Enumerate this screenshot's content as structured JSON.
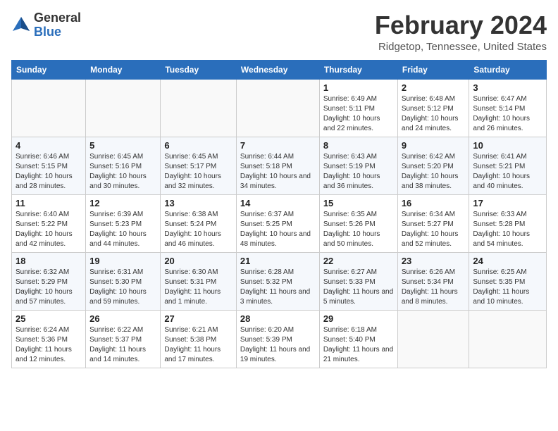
{
  "header": {
    "logo_general": "General",
    "logo_blue": "Blue",
    "title": "February 2024",
    "subtitle": "Ridgetop, Tennessee, United States"
  },
  "weekdays": [
    "Sunday",
    "Monday",
    "Tuesday",
    "Wednesday",
    "Thursday",
    "Friday",
    "Saturday"
  ],
  "weeks": [
    [
      {
        "day": "",
        "sunrise": "",
        "sunset": "",
        "daylight": "",
        "empty": true
      },
      {
        "day": "",
        "sunrise": "",
        "sunset": "",
        "daylight": "",
        "empty": true
      },
      {
        "day": "",
        "sunrise": "",
        "sunset": "",
        "daylight": "",
        "empty": true
      },
      {
        "day": "",
        "sunrise": "",
        "sunset": "",
        "daylight": "",
        "empty": true
      },
      {
        "day": "1",
        "sunrise": "Sunrise: 6:49 AM",
        "sunset": "Sunset: 5:11 PM",
        "daylight": "Daylight: 10 hours and 22 minutes.",
        "empty": false
      },
      {
        "day": "2",
        "sunrise": "Sunrise: 6:48 AM",
        "sunset": "Sunset: 5:12 PM",
        "daylight": "Daylight: 10 hours and 24 minutes.",
        "empty": false
      },
      {
        "day": "3",
        "sunrise": "Sunrise: 6:47 AM",
        "sunset": "Sunset: 5:14 PM",
        "daylight": "Daylight: 10 hours and 26 minutes.",
        "empty": false
      }
    ],
    [
      {
        "day": "4",
        "sunrise": "Sunrise: 6:46 AM",
        "sunset": "Sunset: 5:15 PM",
        "daylight": "Daylight: 10 hours and 28 minutes.",
        "empty": false
      },
      {
        "day": "5",
        "sunrise": "Sunrise: 6:45 AM",
        "sunset": "Sunset: 5:16 PM",
        "daylight": "Daylight: 10 hours and 30 minutes.",
        "empty": false
      },
      {
        "day": "6",
        "sunrise": "Sunrise: 6:45 AM",
        "sunset": "Sunset: 5:17 PM",
        "daylight": "Daylight: 10 hours and 32 minutes.",
        "empty": false
      },
      {
        "day": "7",
        "sunrise": "Sunrise: 6:44 AM",
        "sunset": "Sunset: 5:18 PM",
        "daylight": "Daylight: 10 hours and 34 minutes.",
        "empty": false
      },
      {
        "day": "8",
        "sunrise": "Sunrise: 6:43 AM",
        "sunset": "Sunset: 5:19 PM",
        "daylight": "Daylight: 10 hours and 36 minutes.",
        "empty": false
      },
      {
        "day": "9",
        "sunrise": "Sunrise: 6:42 AM",
        "sunset": "Sunset: 5:20 PM",
        "daylight": "Daylight: 10 hours and 38 minutes.",
        "empty": false
      },
      {
        "day": "10",
        "sunrise": "Sunrise: 6:41 AM",
        "sunset": "Sunset: 5:21 PM",
        "daylight": "Daylight: 10 hours and 40 minutes.",
        "empty": false
      }
    ],
    [
      {
        "day": "11",
        "sunrise": "Sunrise: 6:40 AM",
        "sunset": "Sunset: 5:22 PM",
        "daylight": "Daylight: 10 hours and 42 minutes.",
        "empty": false
      },
      {
        "day": "12",
        "sunrise": "Sunrise: 6:39 AM",
        "sunset": "Sunset: 5:23 PM",
        "daylight": "Daylight: 10 hours and 44 minutes.",
        "empty": false
      },
      {
        "day": "13",
        "sunrise": "Sunrise: 6:38 AM",
        "sunset": "Sunset: 5:24 PM",
        "daylight": "Daylight: 10 hours and 46 minutes.",
        "empty": false
      },
      {
        "day": "14",
        "sunrise": "Sunrise: 6:37 AM",
        "sunset": "Sunset: 5:25 PM",
        "daylight": "Daylight: 10 hours and 48 minutes.",
        "empty": false
      },
      {
        "day": "15",
        "sunrise": "Sunrise: 6:35 AM",
        "sunset": "Sunset: 5:26 PM",
        "daylight": "Daylight: 10 hours and 50 minutes.",
        "empty": false
      },
      {
        "day": "16",
        "sunrise": "Sunrise: 6:34 AM",
        "sunset": "Sunset: 5:27 PM",
        "daylight": "Daylight: 10 hours and 52 minutes.",
        "empty": false
      },
      {
        "day": "17",
        "sunrise": "Sunrise: 6:33 AM",
        "sunset": "Sunset: 5:28 PM",
        "daylight": "Daylight: 10 hours and 54 minutes.",
        "empty": false
      }
    ],
    [
      {
        "day": "18",
        "sunrise": "Sunrise: 6:32 AM",
        "sunset": "Sunset: 5:29 PM",
        "daylight": "Daylight: 10 hours and 57 minutes.",
        "empty": false
      },
      {
        "day": "19",
        "sunrise": "Sunrise: 6:31 AM",
        "sunset": "Sunset: 5:30 PM",
        "daylight": "Daylight: 10 hours and 59 minutes.",
        "empty": false
      },
      {
        "day": "20",
        "sunrise": "Sunrise: 6:30 AM",
        "sunset": "Sunset: 5:31 PM",
        "daylight": "Daylight: 11 hours and 1 minute.",
        "empty": false
      },
      {
        "day": "21",
        "sunrise": "Sunrise: 6:28 AM",
        "sunset": "Sunset: 5:32 PM",
        "daylight": "Daylight: 11 hours and 3 minutes.",
        "empty": false
      },
      {
        "day": "22",
        "sunrise": "Sunrise: 6:27 AM",
        "sunset": "Sunset: 5:33 PM",
        "daylight": "Daylight: 11 hours and 5 minutes.",
        "empty": false
      },
      {
        "day": "23",
        "sunrise": "Sunrise: 6:26 AM",
        "sunset": "Sunset: 5:34 PM",
        "daylight": "Daylight: 11 hours and 8 minutes.",
        "empty": false
      },
      {
        "day": "24",
        "sunrise": "Sunrise: 6:25 AM",
        "sunset": "Sunset: 5:35 PM",
        "daylight": "Daylight: 11 hours and 10 minutes.",
        "empty": false
      }
    ],
    [
      {
        "day": "25",
        "sunrise": "Sunrise: 6:24 AM",
        "sunset": "Sunset: 5:36 PM",
        "daylight": "Daylight: 11 hours and 12 minutes.",
        "empty": false
      },
      {
        "day": "26",
        "sunrise": "Sunrise: 6:22 AM",
        "sunset": "Sunset: 5:37 PM",
        "daylight": "Daylight: 11 hours and 14 minutes.",
        "empty": false
      },
      {
        "day": "27",
        "sunrise": "Sunrise: 6:21 AM",
        "sunset": "Sunset: 5:38 PM",
        "daylight": "Daylight: 11 hours and 17 minutes.",
        "empty": false
      },
      {
        "day": "28",
        "sunrise": "Sunrise: 6:20 AM",
        "sunset": "Sunset: 5:39 PM",
        "daylight": "Daylight: 11 hours and 19 minutes.",
        "empty": false
      },
      {
        "day": "29",
        "sunrise": "Sunrise: 6:18 AM",
        "sunset": "Sunset: 5:40 PM",
        "daylight": "Daylight: 11 hours and 21 minutes.",
        "empty": false
      },
      {
        "day": "",
        "sunrise": "",
        "sunset": "",
        "daylight": "",
        "empty": true
      },
      {
        "day": "",
        "sunrise": "",
        "sunset": "",
        "daylight": "",
        "empty": true
      }
    ]
  ]
}
